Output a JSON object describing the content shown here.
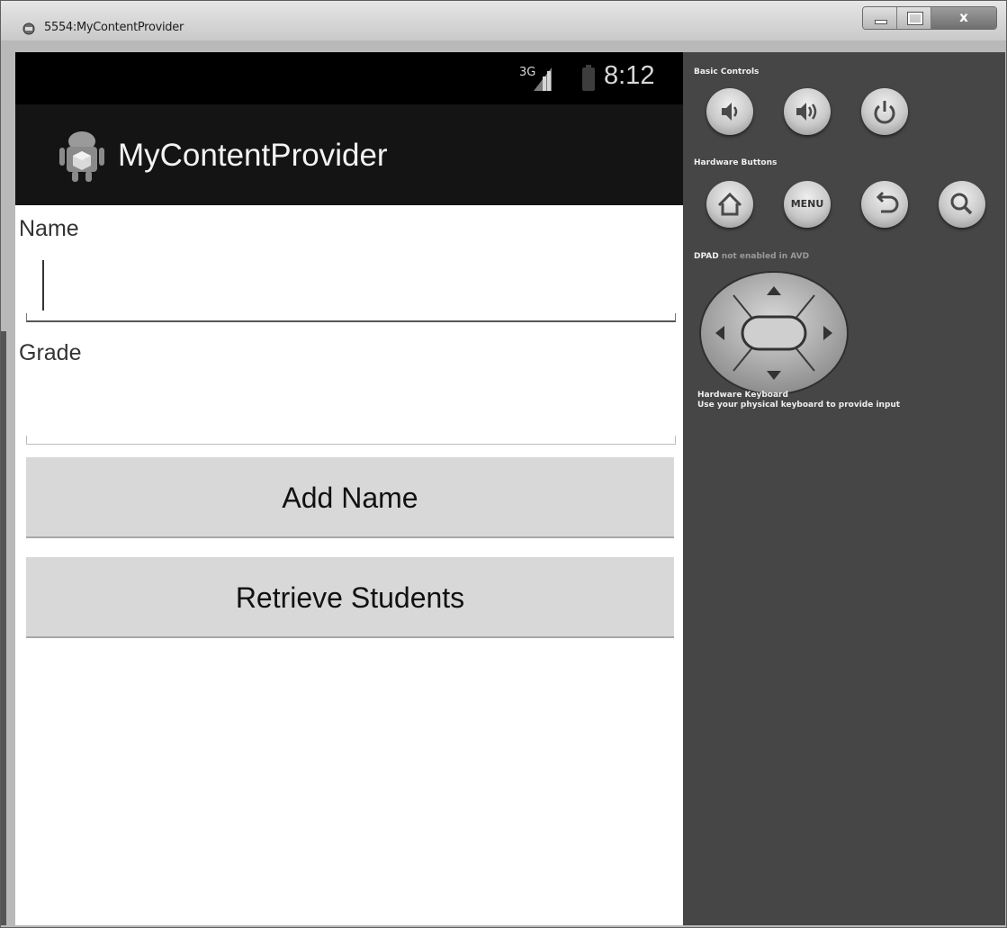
{
  "window": {
    "title": "5554:MyContentProvider",
    "close_label": "x"
  },
  "device": {
    "status_bar": {
      "network": "3G",
      "time": "8:12"
    },
    "action_bar": {
      "app_title": "MyContentProvider",
      "icon": "android-app-icon"
    },
    "form": {
      "name_label": "Name",
      "name_value": "",
      "grade_label": "Grade",
      "grade_value": "",
      "add_button_label": "Add Name",
      "retrieve_button_label": "Retrieve Students"
    }
  },
  "controls": {
    "basic_controls_heading": "Basic Controls",
    "basic_controls": [
      {
        "name": "volume-down-icon"
      },
      {
        "name": "volume-up-icon"
      },
      {
        "name": "power-icon"
      }
    ],
    "hardware_buttons_heading": "Hardware Buttons",
    "hardware_buttons": [
      {
        "name": "home-icon"
      },
      {
        "name": "menu-button",
        "label": "MENU"
      },
      {
        "name": "back-icon"
      },
      {
        "name": "search-icon"
      }
    ],
    "dpad_heading": "DPAD",
    "dpad_note": "not enabled in AVD",
    "keyboard_heading": "Hardware Keyboard",
    "keyboard_note": "Use your physical keyboard to provide input"
  }
}
